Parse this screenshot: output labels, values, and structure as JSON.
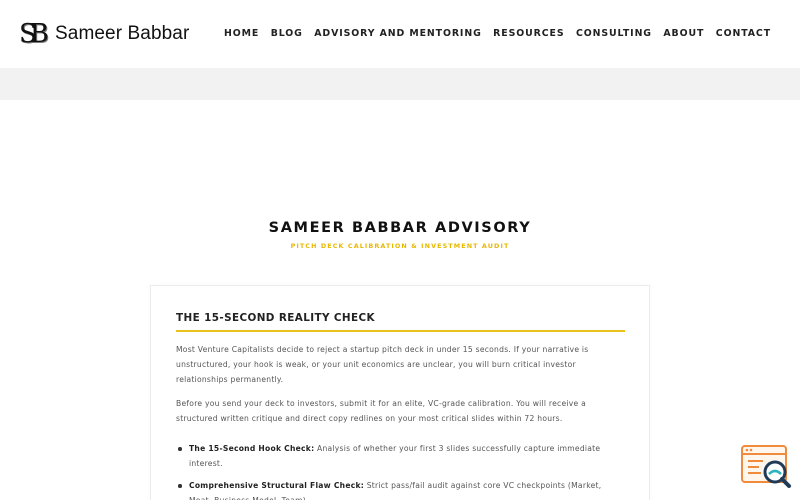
{
  "header": {
    "logo_mark": "SB",
    "logo_name": "Sameer Babbar",
    "nav": [
      "HOME",
      "BLOG",
      "ADVISORY AND MENTORING",
      "RESOURCES",
      "CONSULTING",
      "ABOUT",
      "CONTACT"
    ]
  },
  "hero": {
    "title": "SAMEER BABBAR ADVISORY",
    "subtitle": "PITCH DECK CALIBRATION & INVESTMENT AUDIT"
  },
  "card": {
    "heading": "THE 15-SECOND REALITY CHECK",
    "paragraph1": "Most Venture Capitalists decide to reject a startup pitch deck in under 15 seconds. If your narrative is unstructured, your hook is weak, or your unit economics are unclear, you will burn critical investor relationships permanently.",
    "paragraph2": "Before you send your deck to investors, submit it for an elite, VC-grade calibration. You will receive a structured written critique and direct copy redlines on your most critical slides within 72 hours.",
    "features": [
      {
        "title": "The 15-Second Hook Check:",
        "text": " Analysis of whether your first 3 slides successfully capture immediate interest."
      },
      {
        "title": "Comprehensive Structural Flaw Check:",
        "text": " Strict pass/fail audit against core VC checkpoints (Market, Moat, Business Model, Team)."
      }
    ]
  },
  "chat_widget": {
    "icon": "chat-search-icon"
  },
  "colors": {
    "accent": "#e8c11a",
    "subtitle": "#e8b800",
    "band": "#f2f2f2",
    "widget": "#f08a3c"
  }
}
